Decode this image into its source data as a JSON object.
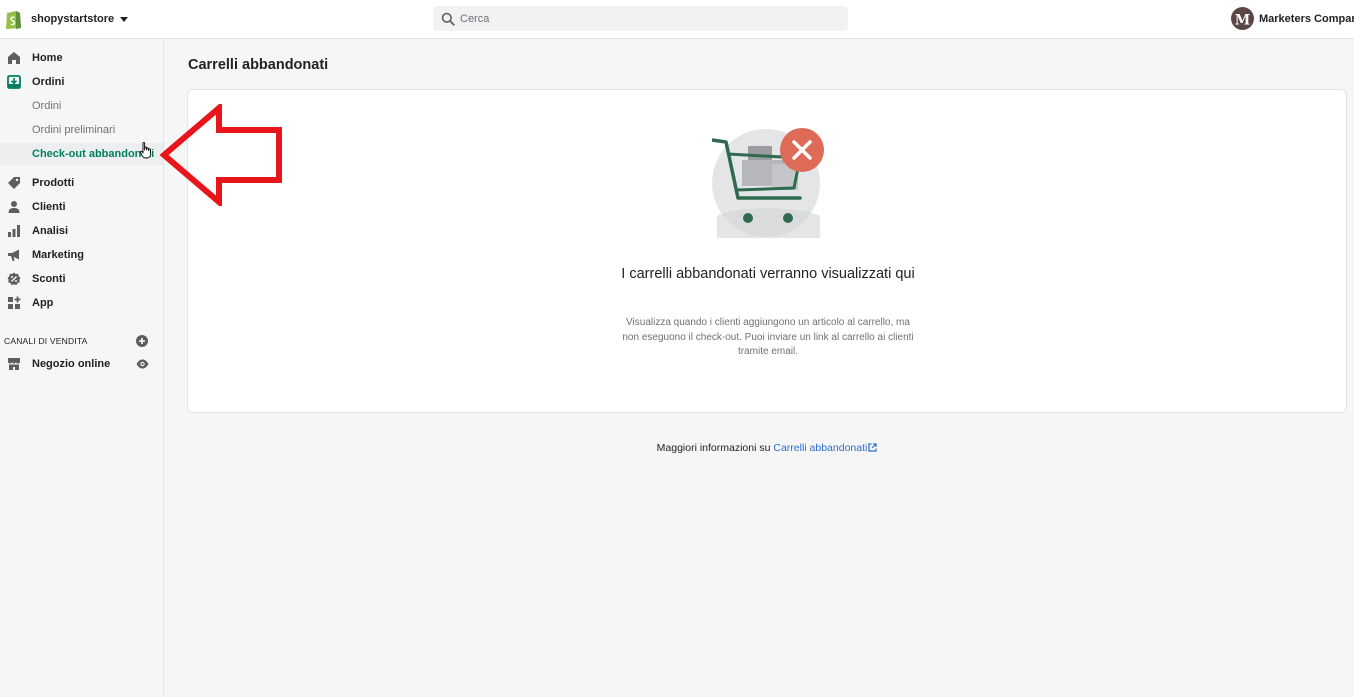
{
  "topbar": {
    "store_name": "shopystartstore",
    "search_placeholder": "Cerca",
    "account_name": "Marketers Company",
    "avatar_initial": "M"
  },
  "sidebar": {
    "items": [
      {
        "label": "Home",
        "icon": "home-icon"
      },
      {
        "label": "Ordini",
        "icon": "orders-icon"
      },
      {
        "label": "Prodotti",
        "icon": "tag-icon"
      },
      {
        "label": "Clienti",
        "icon": "person-icon"
      },
      {
        "label": "Analisi",
        "icon": "bar-chart-icon"
      },
      {
        "label": "Marketing",
        "icon": "megaphone-icon"
      },
      {
        "label": "Sconti",
        "icon": "discount-icon"
      },
      {
        "label": "App",
        "icon": "apps-icon"
      }
    ],
    "order_subitems": [
      {
        "label": "Ordini"
      },
      {
        "label": "Ordini preliminari"
      },
      {
        "label": "Check-out abbandonati",
        "active": true
      }
    ],
    "sales_channels_title": "CANALI DI VENDITA",
    "online_store_label": "Negozio online"
  },
  "main": {
    "page_title": "Carrelli abbandonati",
    "empty_state": {
      "heading": "I carrelli abbandonati verranno visualizzati qui",
      "body": "Visualizza quando i clienti aggiungono un articolo al carrello, ma non eseguono il check-out. Puoi inviare un link al carrello ai clienti tramite email."
    },
    "footer": {
      "prefix": "Maggiori informazioni su ",
      "link_label": "Carrelli abbandonati"
    }
  },
  "colors": {
    "accent_green": "#007f5f",
    "link_blue": "#2c6ecb",
    "annotation_red": "#e8151b",
    "error_badge": "#de6b57"
  }
}
